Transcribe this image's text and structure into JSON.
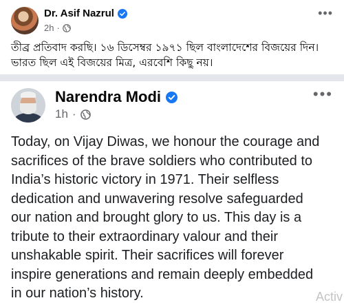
{
  "top_post": {
    "author": "Dr. Asif Nazrul",
    "time": "2h",
    "separator": "·",
    "more": "•••",
    "text_line1": "তীব্র প্রতিবাদ করছি। ১৬ ডিসেম্বর ১৯৭১ ছিল বাংলাদেশের বিজয়ের দিন।",
    "text_line2": "ভারত ছিল এই বিজয়ের মিত্র, এরবেশি কিছু নয়।",
    "verified_icon": "verified-badge-icon",
    "privacy_icon": "globe-icon"
  },
  "bottom_post": {
    "author": "Narendra Modi",
    "time": "1h",
    "separator": "·",
    "more": "•••",
    "lines": [
      "Today, on Vijay Diwas, we honour the courage and",
      "sacrifices of the brave soldiers who contributed to",
      "India’s historic victory in 1971. Their selfless",
      "dedication and unwavering resolve safeguarded",
      "our nation and brought glory to us. This day is a",
      "tribute to their extraordinary valour and their",
      "unshakable spirit. Their sacrifices will forever",
      "inspire generations and remain deeply embedded",
      "in our nation’s history."
    ],
    "verified_icon": "verified-badge-icon",
    "privacy_icon": "globe-icon"
  },
  "watermark": "Activ",
  "colors": {
    "verified_blue": "#1877f2",
    "meta_gray": "#65676b",
    "divider": "#e4e6eb"
  }
}
